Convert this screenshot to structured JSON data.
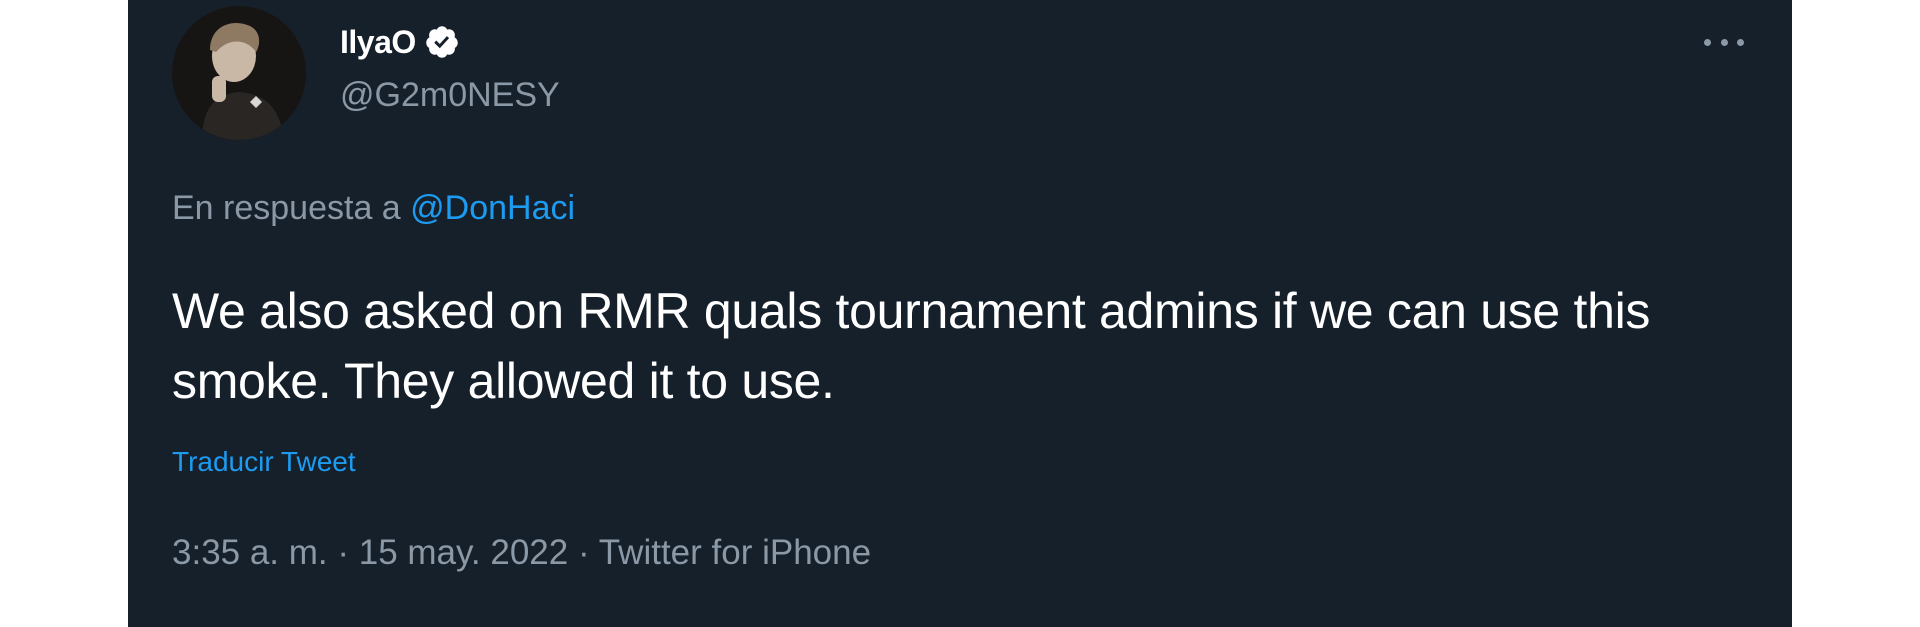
{
  "author": {
    "display_name": "IlyaO",
    "handle": "@G2m0NESY",
    "verified_icon": "verified-badge-icon",
    "avatar": "avatar"
  },
  "reply": {
    "prefix": "En respuesta a ",
    "mention": "@DonHaci"
  },
  "tweet": {
    "text": "We also asked on RMR quals tournament admins if we can use this smoke. They allowed it to use."
  },
  "actions": {
    "translate": "Traducir Tweet",
    "more_icon": "more-options-icon"
  },
  "meta": {
    "time": "3:35 a. m.",
    "sep1": " · ",
    "date": "15 may. 2022",
    "sep2": " · ",
    "source": "Twitter for iPhone"
  },
  "colors": {
    "background": "#15202b",
    "text": "#ffffff",
    "secondary_text": "#8b98a5",
    "link": "#1d9bf0"
  }
}
